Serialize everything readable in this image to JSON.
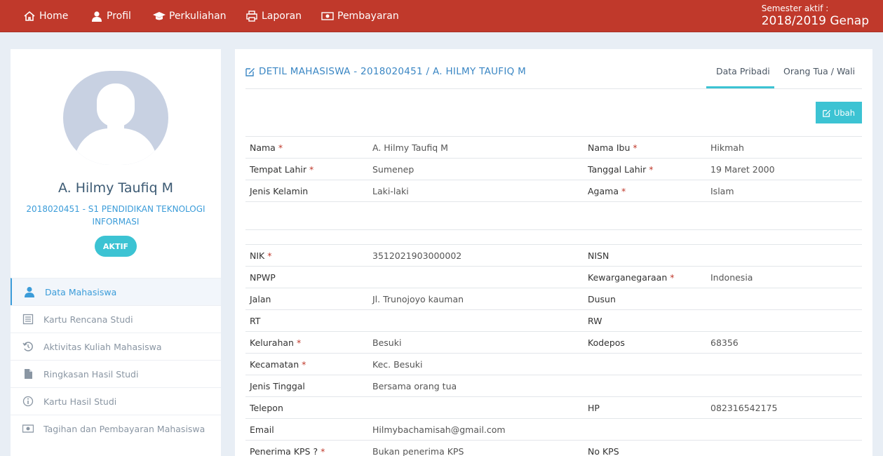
{
  "nav": {
    "items": [
      {
        "label": "Home",
        "icon": "home-icon"
      },
      {
        "label": "Profil",
        "icon": "user-icon"
      },
      {
        "label": "Perkuliahan",
        "icon": "graduation-cap-icon"
      },
      {
        "label": "Laporan",
        "icon": "printer-icon"
      },
      {
        "label": "Pembayaran",
        "icon": "money-icon"
      }
    ],
    "semester_label": "Semester aktif :",
    "semester_value": "2018/2019 Genap"
  },
  "profile": {
    "name": "A. Hilmy Taufiq M",
    "program": "2018020451 - S1 PENDIDIKAN TEKNOLOGI INFORMASI",
    "status": "AKTIF"
  },
  "sidebar": {
    "items": [
      {
        "label": "Data Mahasiswa",
        "icon": "user-icon",
        "active": true
      },
      {
        "label": "Kartu Rencana Studi",
        "icon": "list-icon"
      },
      {
        "label": "Aktivitas Kuliah Mahasiswa",
        "icon": "history-icon"
      },
      {
        "label": "Ringkasan Hasil Studi",
        "icon": "file-icon"
      },
      {
        "label": "Kartu Hasil Studi",
        "icon": "info-icon"
      },
      {
        "label": "Tagihan dan Pembayaran Mahasiswa",
        "icon": "money-icon"
      }
    ]
  },
  "main": {
    "title": "DETIL MAHASISWA - 2018020451 / A. HILMY TAUFIQ M",
    "tabs": [
      "Data Pribadi",
      "Orang Tua / Wali"
    ],
    "edit_label": "Ubah",
    "required_mark": "*",
    "rows": [
      {
        "l1": "Nama",
        "r1": true,
        "v1": "A. Hilmy Taufiq M",
        "l2": "Nama Ibu",
        "r2": true,
        "v2": "Hikmah"
      },
      {
        "l1": "Tempat Lahir",
        "r1": true,
        "v1": "Sumenep",
        "l2": "Tanggal Lahir",
        "r2": true,
        "v2": "19 Maret 2000"
      },
      {
        "l1": "Jenis Kelamin",
        "r1": false,
        "v1": "Laki-laki",
        "l2": "Agama",
        "r2": true,
        "v2": "Islam"
      },
      {
        "l1": "NIK",
        "r1": true,
        "v1": "3512021903000002",
        "l2": "NISN",
        "r2": false,
        "v2": ""
      },
      {
        "l1": "NPWP",
        "r1": false,
        "v1": "",
        "l2": "Kewarganegaraan",
        "r2": true,
        "v2": "Indonesia"
      },
      {
        "l1": "Jalan",
        "r1": false,
        "v1": "Jl. Trunojoyo kauman",
        "l2": "Dusun",
        "r2": false,
        "v2": ""
      },
      {
        "l1": "RT",
        "r1": false,
        "v1": "",
        "l2": "RW",
        "r2": false,
        "v2": ""
      },
      {
        "l1": "Kelurahan",
        "r1": true,
        "v1": "Besuki",
        "l2": "Kodepos",
        "r2": false,
        "v2": "68356"
      },
      {
        "l1": "Kecamatan",
        "r1": true,
        "v1": "Kec. Besuki",
        "l2": "",
        "r2": false,
        "v2": ""
      },
      {
        "l1": "Jenis Tinggal",
        "r1": false,
        "v1": "Bersama orang tua",
        "l2": "",
        "r2": false,
        "v2": ""
      },
      {
        "l1": "Telepon",
        "r1": false,
        "v1": "",
        "l2": "HP",
        "r2": false,
        "v2": "082316542175"
      },
      {
        "l1": "Email",
        "r1": false,
        "v1": "Hilmybachamisah@gmail.com",
        "l2": "",
        "r2": false,
        "v2": ""
      },
      {
        "l1": "Penerima KPS ?",
        "r1": true,
        "v1": "Bukan penerima KPS",
        "l2": "No KPS",
        "r2": false,
        "v2": ""
      }
    ]
  },
  "colors": {
    "header": "#c0392b",
    "accent": "#3cc3d3",
    "link": "#3b9cd9"
  }
}
